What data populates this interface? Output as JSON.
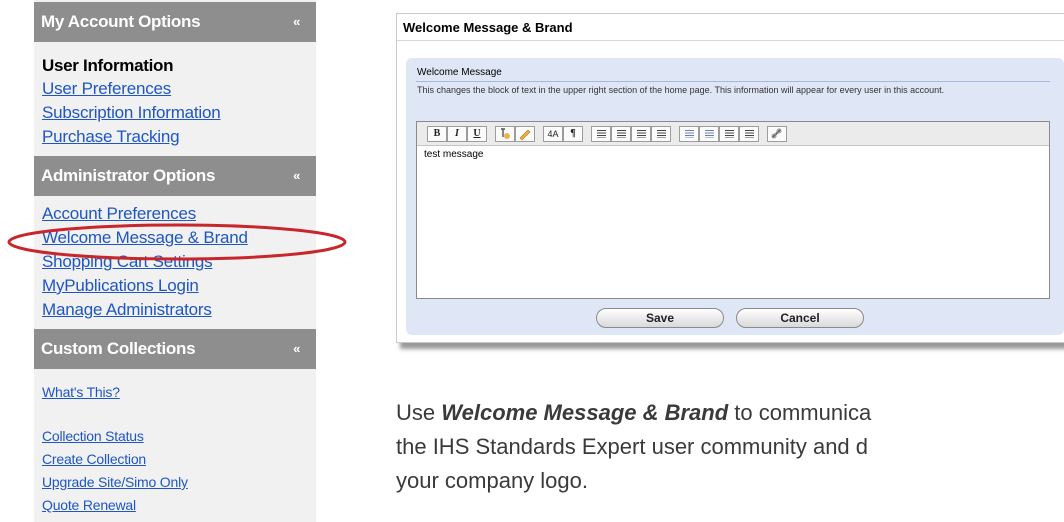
{
  "sidebar": {
    "sections": [
      {
        "title": "My Account Options",
        "chevron": "«"
      },
      {
        "title": "Administrator Options",
        "chevron": "«"
      },
      {
        "title": "Custom Collections",
        "chevron": "«"
      }
    ],
    "account_items": [
      {
        "label": "User Information",
        "current": true
      },
      {
        "label": "User Preferences"
      },
      {
        "label": "Subscription Information"
      },
      {
        "label": "Purchase Tracking"
      }
    ],
    "admin_items": [
      {
        "label": "Account Preferences"
      },
      {
        "label": "Welcome Message & Brand",
        "highlighted": true
      },
      {
        "label": "Shopping Cart Settings"
      },
      {
        "label": "MyPublications Login"
      },
      {
        "label": "Manage Administrators"
      }
    ],
    "collections_help": "What's This?",
    "collections_items": [
      {
        "label": "Collection Status"
      },
      {
        "label": "Create Collection"
      },
      {
        "label": "Upgrade Site/Simo Only"
      },
      {
        "label": "Quote Renewal"
      }
    ]
  },
  "panel": {
    "title": "Welcome Message & Brand",
    "section_title": "Welcome Message",
    "description": "This changes the block of text in the upper right section of the home page. This information will appear for every user in this account.",
    "editor_text": "test message",
    "toolbar_icons": [
      "bold-icon",
      "italic-icon",
      "underline-icon",
      "text-color-icon",
      "highlight-icon",
      "font-size-icon",
      "paragraph-icon",
      "align-left-icon",
      "align-center-icon",
      "align-right-icon",
      "align-justify-icon",
      "outdent-icon",
      "indent-icon",
      "bullet-list-icon",
      "numbered-list-icon",
      "link-icon"
    ],
    "toolbar_glyphs": {
      "bold": "B",
      "italic": "I",
      "underline": "U",
      "font_size": "4A",
      "paragraph": "¶"
    },
    "save_label": "Save",
    "cancel_label": "Cancel"
  },
  "caption": {
    "prefix": "Use ",
    "emphasis": "Welcome Message & Brand",
    "line1_rest": " to communica",
    "line2": "the IHS Standards Expert user community and d",
    "line3": "your company logo."
  },
  "colors": {
    "sidebar_bg": "#f1f1f1",
    "section_header_bg": "#8e8e8e",
    "link": "#1e56c4",
    "highlight_ellipse": "#c8262b",
    "panel_inner_bg": "#dfe7f6"
  }
}
